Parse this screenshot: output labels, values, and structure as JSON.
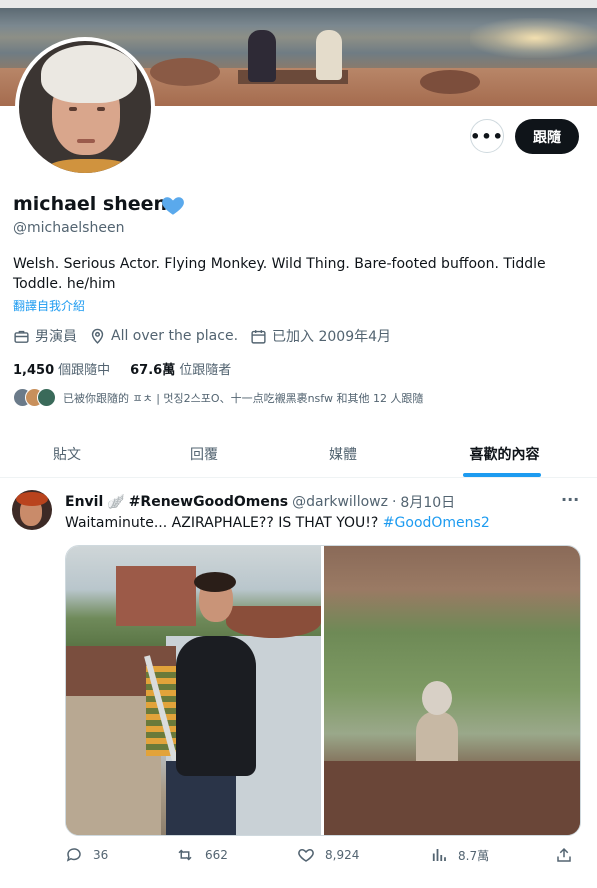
{
  "profile": {
    "name": "michael sheen",
    "handle": "@michaelsheen",
    "bio": "Welsh. Serious Actor. Flying Monkey. Wild Thing. Bare-footed buffoon. Tiddle Toddle. he/him",
    "translate_bio": "翻譯自我介紹",
    "category": "男演員",
    "location": "All over the place.",
    "joined": "已加入 2009年4月",
    "following_count": "1,450",
    "following_label": "個跟隨中",
    "followers_count": "67.6萬",
    "followers_label": "位跟隨者",
    "followed_by": "已被你跟隨的 ㅍㅊ | 멋징2스포O、十一点吃襯黑裹nsfw 和其他 12 人跟隨",
    "verified_heart_color": "#5aa9ec"
  },
  "actions": {
    "more_icon": "ellipsis-icon",
    "follow_label": "跟隨"
  },
  "tabs": [
    {
      "label": "貼文",
      "active": false
    },
    {
      "label": "回覆",
      "active": false
    },
    {
      "label": "媒體",
      "active": false
    },
    {
      "label": "喜歡的內容",
      "active": true
    }
  ],
  "post": {
    "author_name": "Envil",
    "author_emoji": "🪽",
    "author_tag": "#RenewGoodOmens",
    "author_handle": "@darkwillowz",
    "separator": "·",
    "date": "8月10日",
    "text": "Waitaminute... AZIRAPHALE?? IS THAT YOU!? ",
    "hashtag": "#GoodOmens2",
    "stats": {
      "replies": "36",
      "reposts": "662",
      "likes": "8,924",
      "views": "8.7萬"
    }
  },
  "colors": {
    "accent": "#1d9bf0",
    "text": "#0f1419",
    "muted": "#536471"
  }
}
